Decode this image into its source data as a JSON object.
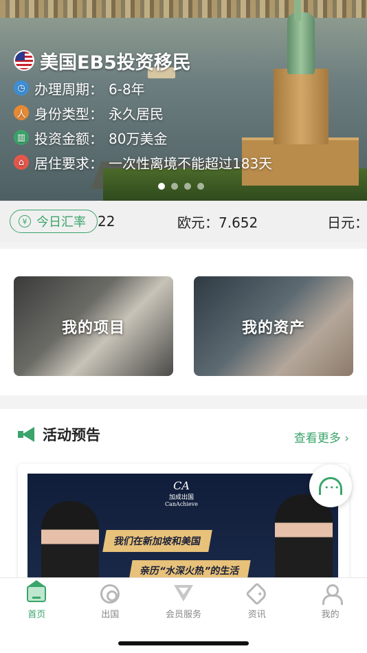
{
  "hero": {
    "title": "美国EB5投资移民",
    "rows": [
      {
        "label": "办理周期：",
        "value": "6-8年",
        "icon": "clock-icon",
        "color": "#3d8fd6"
      },
      {
        "label": "身份类型：",
        "value": "永久居民",
        "icon": "person-icon",
        "color": "#e88a33"
      },
      {
        "label": "投资金额：",
        "value": "80万美金",
        "icon": "money-icon",
        "color": "#3aa46a"
      },
      {
        "label": "居住要求：",
        "value": "一次性离境不能超过183天",
        "icon": "house-icon",
        "color": "#e4574b"
      }
    ],
    "carousel_total": 4,
    "carousel_active": 1
  },
  "exchange": {
    "badge_label": "今日汇率",
    "badge_icon": "yen-icon",
    "items": [
      "22",
      "欧元：7.652",
      "日元："
    ]
  },
  "cards": {
    "my_projects": "我的项目",
    "my_assets": "我的资产"
  },
  "activity": {
    "title": "活动预告",
    "more": "查看更多",
    "banner": {
      "brand_logo": "CA",
      "brand_sub": "加成出国",
      "brand_name": "CanAchieve",
      "line1": "我们在新加坡和美国",
      "line2": "亲历“水深火热”的生活"
    }
  },
  "tabs": [
    {
      "label": "首页",
      "icon": "home-icon",
      "active": true
    },
    {
      "label": "出国",
      "icon": "abroad-icon",
      "active": false
    },
    {
      "label": "会员服务",
      "icon": "member-service-icon",
      "active": false
    },
    {
      "label": "资讯",
      "icon": "news-tag-icon",
      "active": false
    },
    {
      "label": "我的",
      "icon": "profile-icon",
      "active": false
    }
  ],
  "colors": {
    "accent": "#3aa46a"
  }
}
